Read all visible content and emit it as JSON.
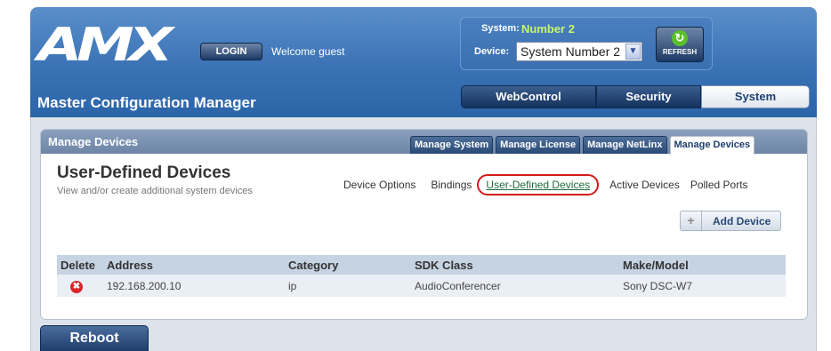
{
  "header": {
    "logo": "AMX",
    "login_label": "LOGIN",
    "welcome_text": "Welcome guest",
    "app_title": "Master Configuration Manager"
  },
  "system_panel": {
    "system_label": "System:",
    "system_value": "Number 2",
    "device_label": "Device:",
    "device_selected": "System Number 2",
    "refresh_label": "REFRESH"
  },
  "main_nav": [
    {
      "label": "WebControl",
      "active": false
    },
    {
      "label": "Security",
      "active": false
    },
    {
      "label": "System",
      "active": true
    }
  ],
  "section": {
    "title": "Manage Devices",
    "tabs": [
      {
        "label": "Manage System",
        "active": false
      },
      {
        "label": "Manage License",
        "active": false
      },
      {
        "label": "Manage NetLinx",
        "active": false
      },
      {
        "label": "Manage Devices",
        "active": true
      }
    ]
  },
  "page": {
    "heading": "User-Defined Devices",
    "subtitle": "View and/or create additional system devices",
    "links": [
      {
        "label": "Device Options",
        "current": false
      },
      {
        "label": "Bindings",
        "current": false
      },
      {
        "label": "User-Defined Devices",
        "current": true
      },
      {
        "label": "Active Devices",
        "current": false
      },
      {
        "label": "Polled Ports",
        "current": false
      }
    ],
    "add_device_label": "Add Device",
    "add_icon": "+"
  },
  "table": {
    "columns": [
      "Delete",
      "Address",
      "Category",
      "SDK Class",
      "Make/Model"
    ],
    "rows": [
      {
        "delete_icon": "✖",
        "address": "192.168.200.10",
        "category": "ip",
        "sdk_class": "AudioConferencer",
        "make_model": "Sony DSC-W7"
      }
    ]
  },
  "footer": {
    "reboot_label": "Reboot"
  },
  "icons": {
    "refresh": "refresh-icon",
    "delete": "delete-icon",
    "add": "plus-icon",
    "dropdown": "chevron-down-icon"
  },
  "colors": {
    "header_blue": "#3a72b6",
    "system_value_green": "#c9f46f",
    "highlight_red": "#d21a1a",
    "delete_red": "#d8262b"
  }
}
